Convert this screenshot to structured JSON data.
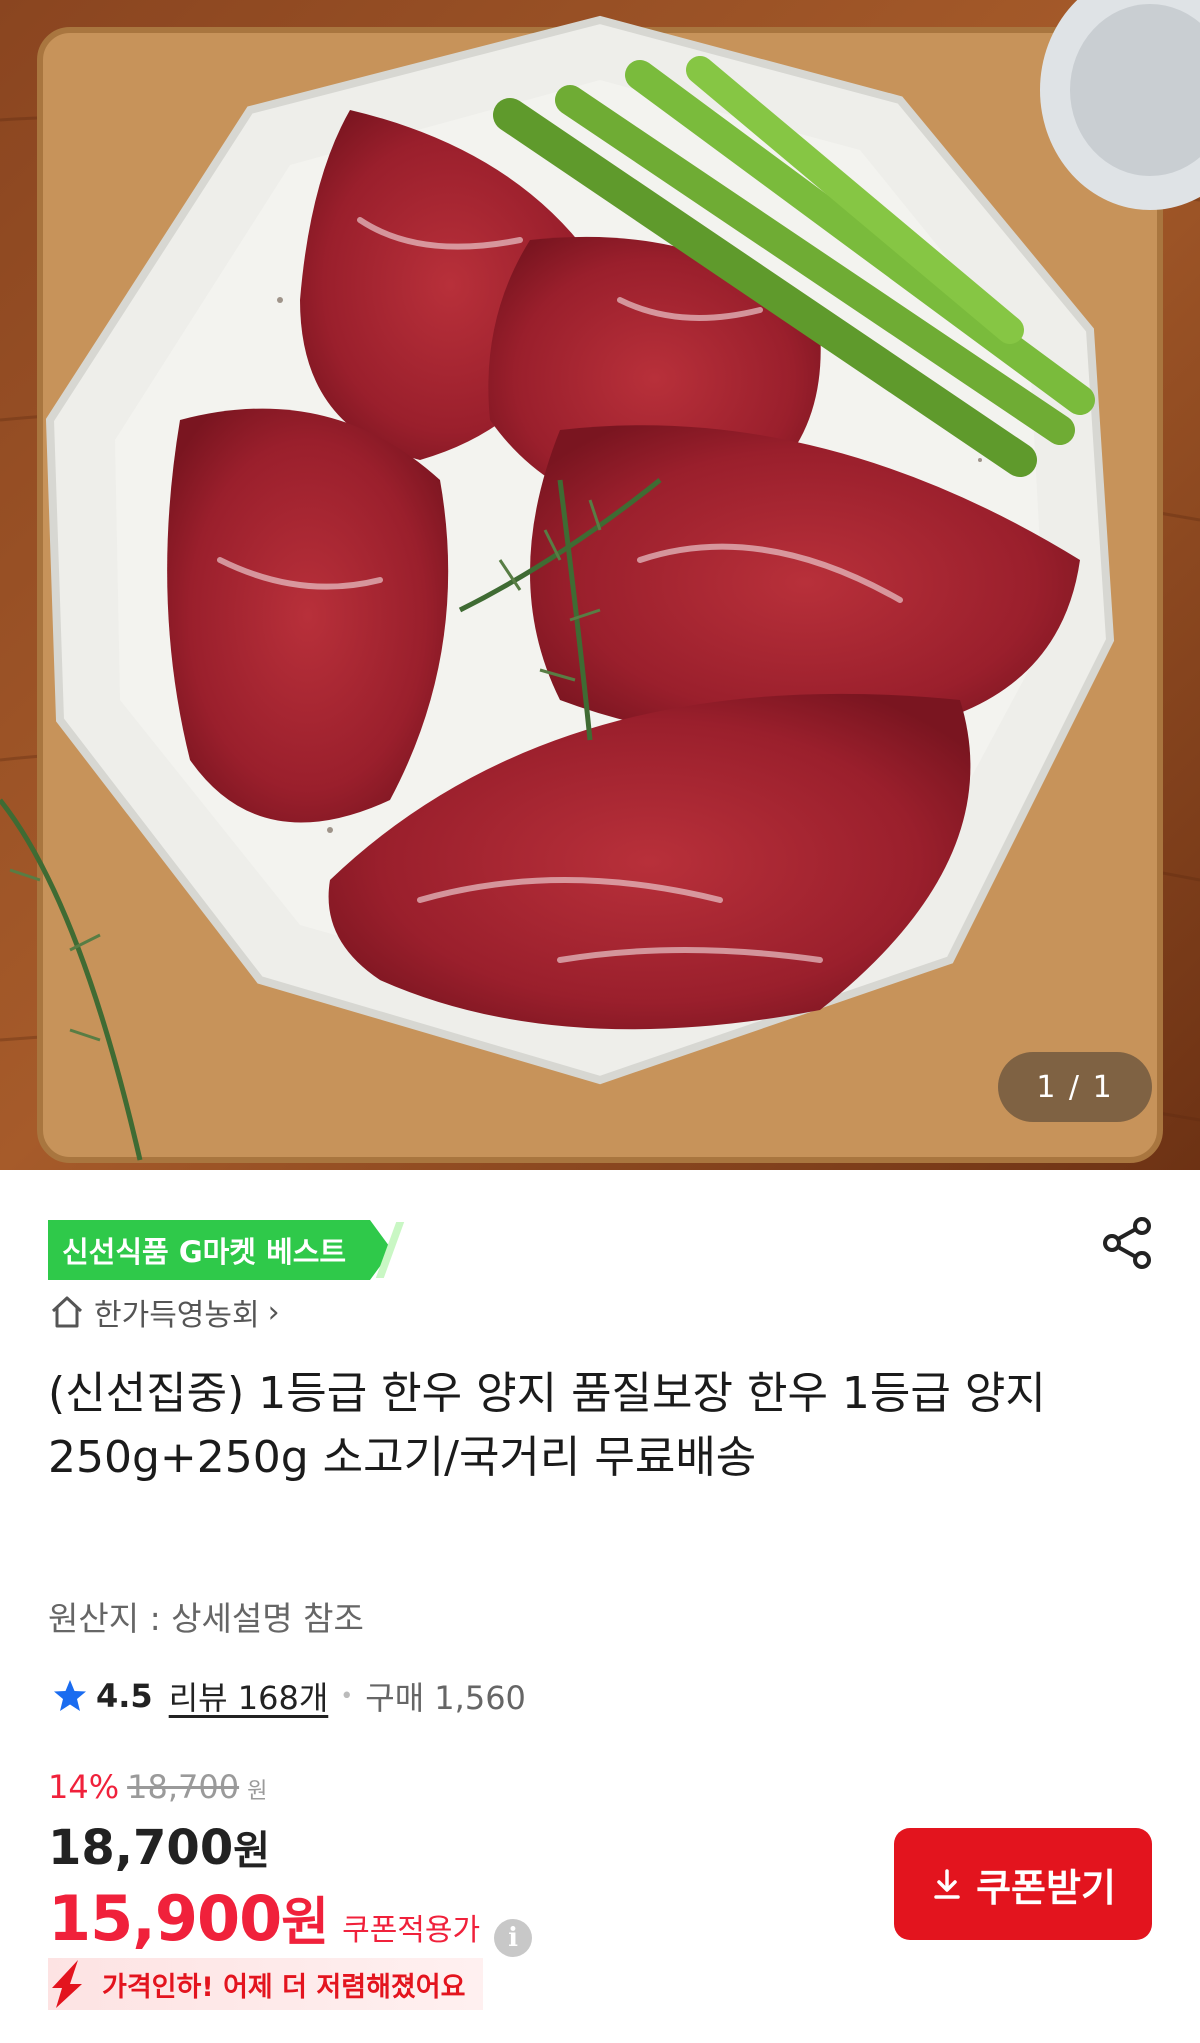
{
  "hero": {
    "image_counter": "1 / 1",
    "image_alt": "한우 양지 고기 접시"
  },
  "badge": {
    "label": "신선식품 G마켓 베스트"
  },
  "seller": {
    "name": "한가득영농회"
  },
  "product": {
    "title": "(신선집중) 1등급 한우 양지 품질보장 한우 1등급 양지 250g+250g 소고기/국거리 무료배송",
    "origin": "원산지 : 상세설명 참조"
  },
  "rating": {
    "score": "4.5",
    "reviews": "리뷰 168개",
    "purchases": "구매 1,560"
  },
  "pricing": {
    "discount_rate": "14%",
    "original_price": "18,700",
    "original_unit": "원",
    "price": "18,700",
    "price_unit": "원",
    "coupon_price": "15,900",
    "coupon_unit": "원",
    "coupon_label": "쿠폰적용가",
    "info_icon": "i",
    "coupon_button": "쿠폰받기",
    "price_drop_message": "가격인하! 어제 더 저렴해졌어요"
  },
  "colors": {
    "accent_red": "#e3141e",
    "badge_green": "#2fc94a",
    "star_blue": "#1a6cf0"
  },
  "icons": {
    "share": "share-icon",
    "home": "home-icon",
    "star": "star-icon",
    "info": "info-icon",
    "download": "download-icon",
    "price_down": "arrow-down-icon"
  }
}
